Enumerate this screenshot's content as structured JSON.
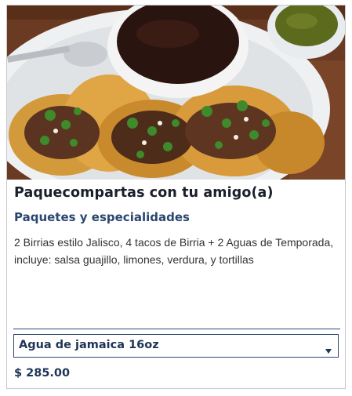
{
  "product": {
    "title": "Paquecompartas con tu amigo(a)",
    "category": "Paquetes y especialidades",
    "description": "2 Birrias estilo Jalisco, 4 tacos de Birria + 2 Aguas de Temporada, incluye: salsa guajillo, limones, verdura, y tortillas",
    "option_selected": "Agua de jamaica 16oz",
    "price": "$ 285.00"
  },
  "icons": {
    "dropdown": "chevron-down-icon"
  },
  "colors": {
    "title": "#1a1f2b",
    "accent": "#2a4670",
    "price": "#1e3456"
  }
}
